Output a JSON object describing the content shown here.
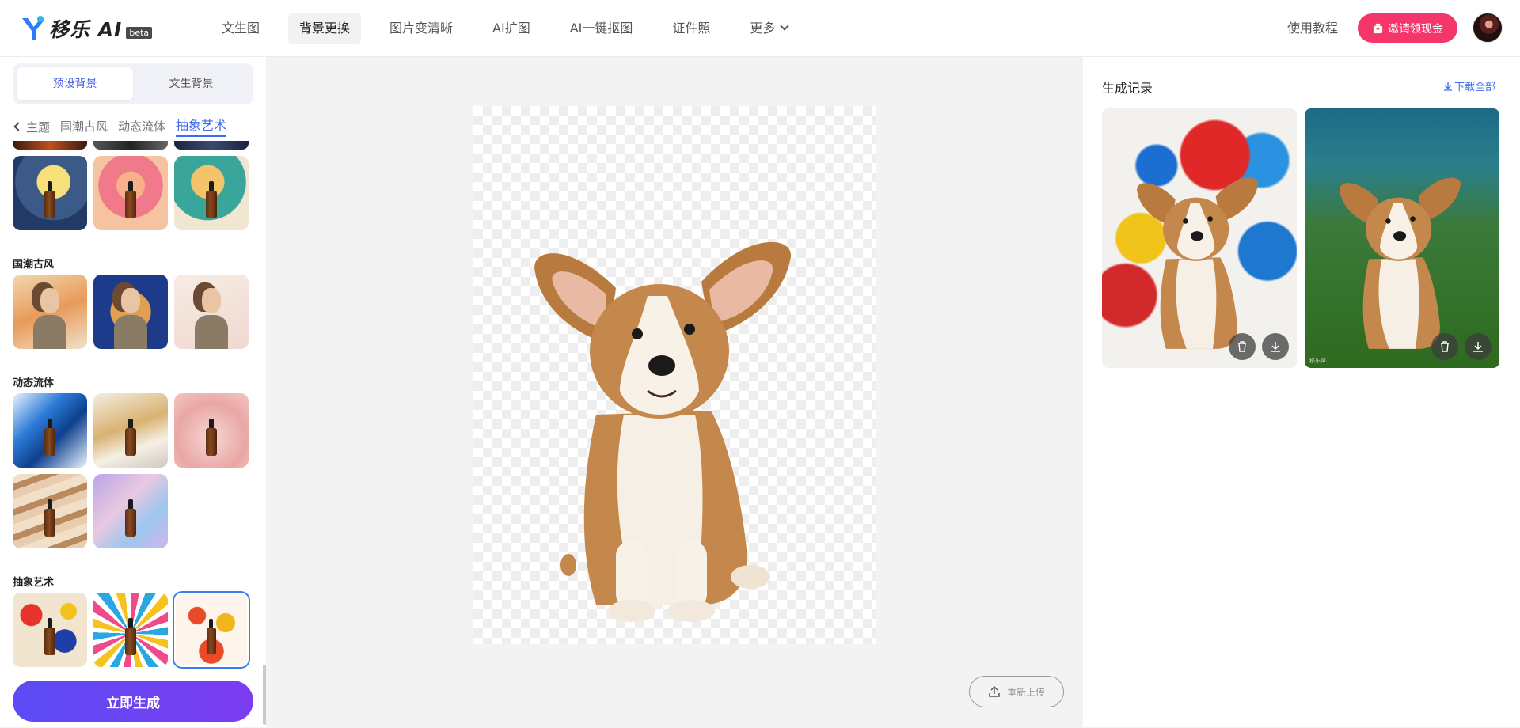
{
  "header": {
    "logo_text": "移乐 AI",
    "logo_badge": "beta",
    "nav": [
      {
        "label": "文生图",
        "active": false
      },
      {
        "label": "背景更换",
        "active": true
      },
      {
        "label": "图片变清晰",
        "active": false
      },
      {
        "label": "AI扩图",
        "active": false
      },
      {
        "label": "AI一键抠图",
        "active": false
      },
      {
        "label": "证件照",
        "active": false
      },
      {
        "label": "更多",
        "active": false
      }
    ],
    "tutorial": "使用教程",
    "invite": "邀请领现金"
  },
  "left": {
    "tabs": [
      {
        "label": "预设背景",
        "active": true
      },
      {
        "label": "文生背景",
        "active": false
      }
    ],
    "categories": {
      "back": "主题",
      "items": [
        "国潮古风",
        "动态流体",
        "抽象艺术"
      ],
      "active": "抽象艺术"
    },
    "sections": [
      {
        "title": "国潮古风"
      },
      {
        "title": "动态流体"
      },
      {
        "title": "抽象艺术"
      }
    ],
    "generate_button": "立即生成"
  },
  "canvas": {
    "reupload": "重新上传"
  },
  "right": {
    "title": "生成记录",
    "download_all": "下载全部",
    "watermark": "移乐AI"
  },
  "colors": {
    "accent": "#3b6cf0",
    "invite": "#f5366a",
    "generate_start": "#5c4cf5",
    "generate_end": "#7c3cf0"
  }
}
